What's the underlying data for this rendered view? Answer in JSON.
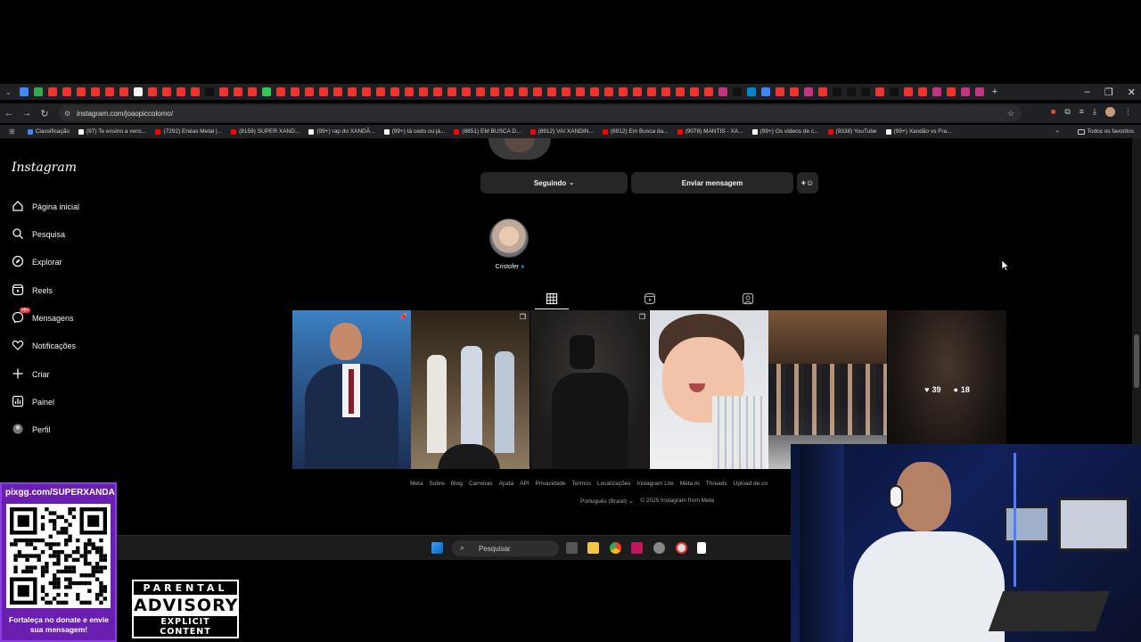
{
  "browser": {
    "url": "instagram.com/joaopiccolomo/",
    "bookmarks": [
      {
        "label": "Classificação",
        "color": "#4285f4"
      },
      {
        "label": "(97) Te ensino a venc...",
        "color": "#fff"
      },
      {
        "label": "(7292) Enéas Metal |...",
        "color": "#ff0000"
      },
      {
        "label": "(8159) SUPER XAND...",
        "color": "#ff0000"
      },
      {
        "label": "(99+) rap do XANDÃ...",
        "color": "#fff"
      },
      {
        "label": "(99+) tá cedo ou já...",
        "color": "#fff"
      },
      {
        "label": "(8851) EM BUSCA D...",
        "color": "#ff0000"
      },
      {
        "label": "(8912) VAI XANDIN...",
        "color": "#ff0000"
      },
      {
        "label": "(8912) Em Busca da...",
        "color": "#ff0000"
      },
      {
        "label": "(9078) MANTIS - XA...",
        "color": "#ff0000"
      },
      {
        "label": "(99+) Os vídeos de c...",
        "color": "#fff"
      },
      {
        "label": "(9338) YouTube",
        "color": "#ff0000"
      },
      {
        "label": "(99+) Xandão vs Fra...",
        "color": "#fff"
      }
    ],
    "favorites_label": "Todos os favoritos"
  },
  "instagram": {
    "logo": "Instagram",
    "nav": [
      {
        "label": "Página inicial",
        "icon": "home-icon"
      },
      {
        "label": "Pesquisa",
        "icon": "search-icon"
      },
      {
        "label": "Explorar",
        "icon": "compass-icon"
      },
      {
        "label": "Reels",
        "icon": "reels-icon"
      },
      {
        "label": "Mensagens",
        "icon": "messenger-icon",
        "badge": "99+"
      },
      {
        "label": "Notificações",
        "icon": "heart-icon"
      },
      {
        "label": "Criar",
        "icon": "plus-icon"
      },
      {
        "label": "Painel",
        "icon": "chart-icon"
      },
      {
        "label": "Perfil",
        "icon": "avatar-icon"
      }
    ],
    "following_button": "Seguindo",
    "message_button": "Enviar mensagem",
    "highlight_label": "Cristofer",
    "post6_likes": "39",
    "post6_comments": "18",
    "footer_links": [
      "Meta",
      "Sobre",
      "Blog",
      "Carreiras",
      "Ajuda",
      "API",
      "Privacidade",
      "Termos",
      "Localizações",
      "Instagram Lite",
      "Meta AI",
      "Threads",
      "Upload de co"
    ],
    "language": "Português (Brasil)",
    "copyright": "© 2025 Instagram from Meta"
  },
  "taskbar": {
    "search_placeholder": "Pesquisar"
  },
  "overlay": {
    "pix_url": "pixgg.com/SUPERXANDA",
    "pix_message": "Fortaleça no donate e envie sua mensagem!",
    "advisory_top": "PARENTAL",
    "advisory_mid": "ADVISORY",
    "advisory_bottom": "EXPLICIT CONTENT"
  },
  "colors": {
    "accent_red": "#ff3040",
    "verified_blue": "#0095f6",
    "pix_purple": "#6a1fb0"
  }
}
